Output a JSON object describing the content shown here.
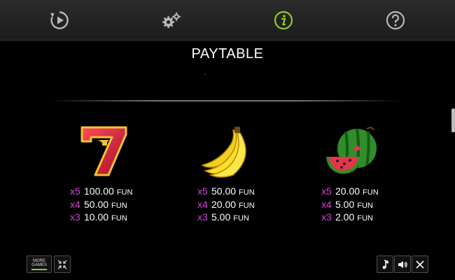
{
  "tabs": [
    {
      "icon": "replay-icon",
      "active": false
    },
    {
      "icon": "settings-gears-icon",
      "active": false
    },
    {
      "icon": "info-icon",
      "active": true
    },
    {
      "icon": "help-icon",
      "active": false
    }
  ],
  "colors": {
    "active_tab": "#8fce2a",
    "inactive_tab": "#b8b8b8",
    "multiplier": "#d542d6"
  },
  "title": "PAYTABLE",
  "paytable": [
    {
      "symbol": "seven",
      "rows": [
        {
          "mult": "x5",
          "value": "100.00",
          "unit": "FUN"
        },
        {
          "mult": "x4",
          "value": "50.00",
          "unit": "FUN"
        },
        {
          "mult": "x3",
          "value": "10.00",
          "unit": "FUN"
        }
      ]
    },
    {
      "symbol": "banana",
      "rows": [
        {
          "mult": "x5",
          "value": "50.00",
          "unit": "FUN"
        },
        {
          "mult": "x4",
          "value": "20.00",
          "unit": "FUN"
        },
        {
          "mult": "x3",
          "value": "5.00",
          "unit": "FUN"
        }
      ]
    },
    {
      "symbol": "watermelon",
      "rows": [
        {
          "mult": "x5",
          "value": "20.00",
          "unit": "FUN"
        },
        {
          "mult": "x4",
          "value": "5.00",
          "unit": "FUN"
        },
        {
          "mult": "x3",
          "value": "2.00",
          "unit": "FUN"
        }
      ]
    }
  ],
  "bottom": {
    "more_games_line1": "MORE",
    "more_games_line2": "GAMES",
    "left_icons": [
      "more-games-icon",
      "collapse-icon"
    ],
    "right_icons": [
      "music-icon",
      "sound-icon",
      "close-icon"
    ]
  }
}
